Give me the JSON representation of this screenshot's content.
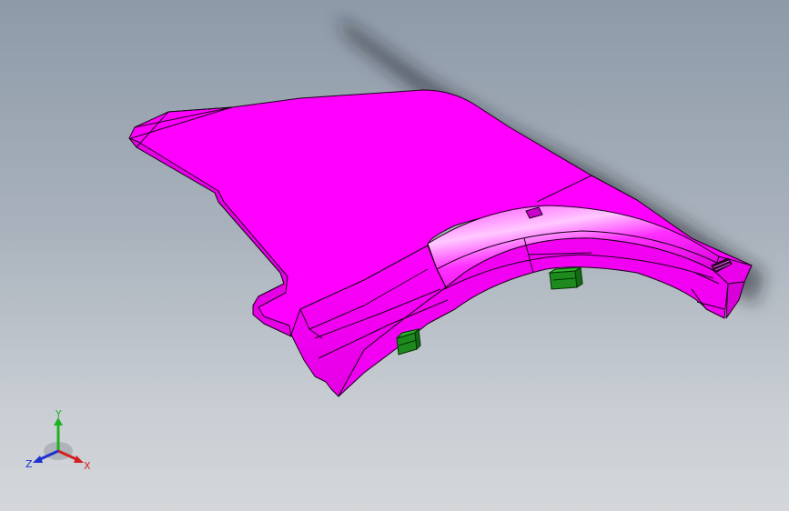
{
  "viewport": {
    "background_top": "#8d9aa8",
    "background_bottom": "#d4d7da"
  },
  "part": {
    "face_color": "#ff00ff",
    "edge_color": "#1a001a",
    "clip_color": "#1e8a1e"
  },
  "triad": {
    "x_label": "X",
    "y_label": "Y",
    "z_label": "Z",
    "x_color": "#d42020",
    "y_color": "#20b020",
    "z_color": "#2030d0"
  }
}
